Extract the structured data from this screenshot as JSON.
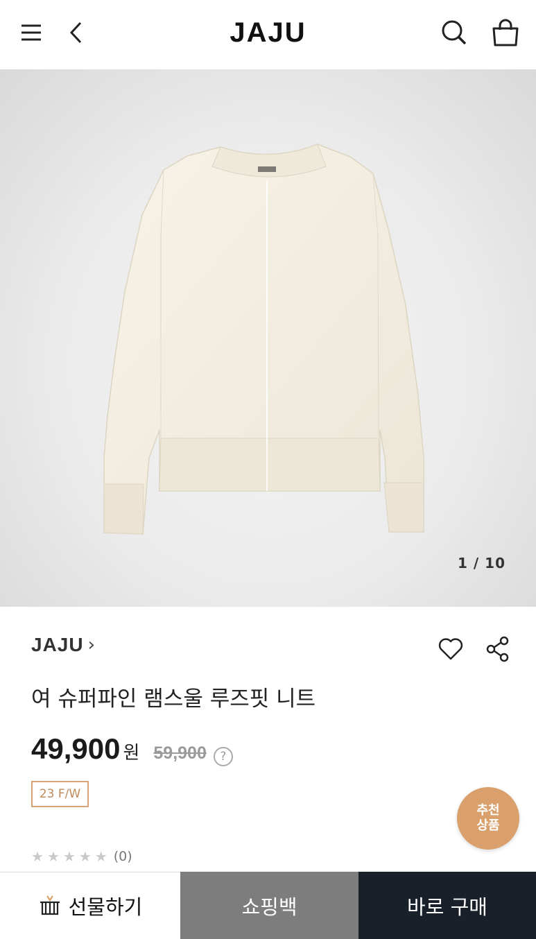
{
  "header": {
    "logo": "JAJU",
    "icons": [
      "menu-icon",
      "back-icon",
      "search-icon",
      "shopping-bag-icon"
    ]
  },
  "gallery": {
    "counter": "1 / 10"
  },
  "product": {
    "brand": "JAJU",
    "brand_arrow": "›",
    "title": "여 슈퍼파인 램스울 루즈핏 니트",
    "price": "49,900",
    "currency": "원",
    "original_price": "59,900",
    "help": "?",
    "season_badge": "23 F/W",
    "rating_count": "(0)",
    "rating_stars": 0
  },
  "floating": {
    "line1": "추천",
    "line2": "상품"
  },
  "bottom_bar": {
    "gift_label": "선물하기",
    "cart_label": "쇼핑백",
    "buy_label": "바로 구매"
  },
  "colors": {
    "accent": "#d9a06c",
    "buy_bg": "#1a2029",
    "cart_bg": "#7d7d7d"
  }
}
